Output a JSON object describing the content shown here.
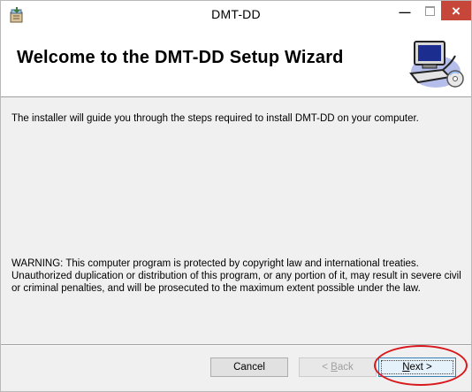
{
  "window": {
    "title": "DMT-DD",
    "minimize_glyph": "—",
    "close_glyph": "×"
  },
  "header": {
    "title": "Welcome to the DMT-DD Setup Wizard",
    "logo_icon": "computer-setup-icon"
  },
  "body": {
    "intro": "The installer will guide you through the steps required to install DMT-DD on your computer.",
    "warning": "WARNING: This computer program is protected by copyright law and international treaties. Unauthorized duplication or distribution of this program, or any portion of it, may result in severe civil or criminal penalties, and will be prosecuted to the maximum extent possible under the law."
  },
  "buttons": {
    "cancel": "Cancel",
    "back_prefix": "< ",
    "back_underlined": "B",
    "back_rest": "ack",
    "next_underlined": "N",
    "next_rest": "ext >"
  },
  "colors": {
    "close_button": "#c7463a",
    "annotation_circle": "#d8181c",
    "default_button_border": "#3c7fb1"
  }
}
